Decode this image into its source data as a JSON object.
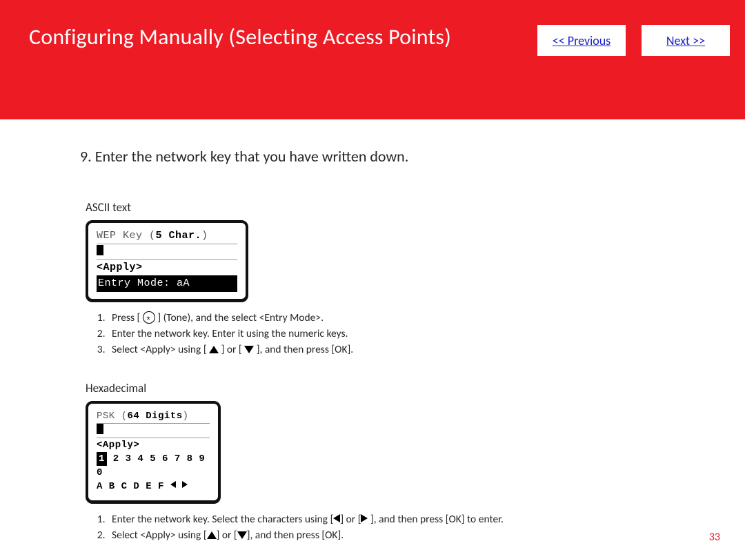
{
  "header": {
    "title": "Configuring Manually (Selecting Access Points)",
    "prev": "<< Previous",
    "next": "Next >>"
  },
  "step": {
    "num": "9.",
    "text": "Enter the network key that you have written down."
  },
  "ascii": {
    "label": "ASCII text",
    "lcd": {
      "line1_prefix": "WEP Key (",
      "line1_count": "5",
      "line1_unit": " Char.",
      "line1_suffix": ")",
      "apply": "<Apply>",
      "entrymode": "Entry Mode: aA"
    },
    "steps": {
      "s1a": "Press [ ",
      "s1b": " ] (Tone), and the select <Entry Mode>.",
      "s2": "Enter the network key. Enter it using the numeric keys.",
      "s3a": "Select <Apply> using [ ",
      "s3b": " ] or [ ",
      "s3c": " ], and then press [OK]."
    }
  },
  "hex": {
    "label": "Hexadecimal",
    "lcd": {
      "line1_prefix": "PSK (",
      "line1_count": "64",
      "line1_unit": " Digits",
      "line1_suffix": ")",
      "apply": "<Apply>",
      "row_digits_rest": " 2 3 4 5 6 7 8 9 0",
      "row_digits_sel": "1",
      "row_letters": "A B C D E F "
    },
    "steps": {
      "s1a": "Enter the network key. Select the characters using [",
      "s1b": "] or [",
      "s1c": " ], and then press [OK] to enter.",
      "s2a": "Select <Apply> using [",
      "s2b": "] or [",
      "s2c": "], and then press [OK]."
    }
  },
  "pagenum": "33"
}
